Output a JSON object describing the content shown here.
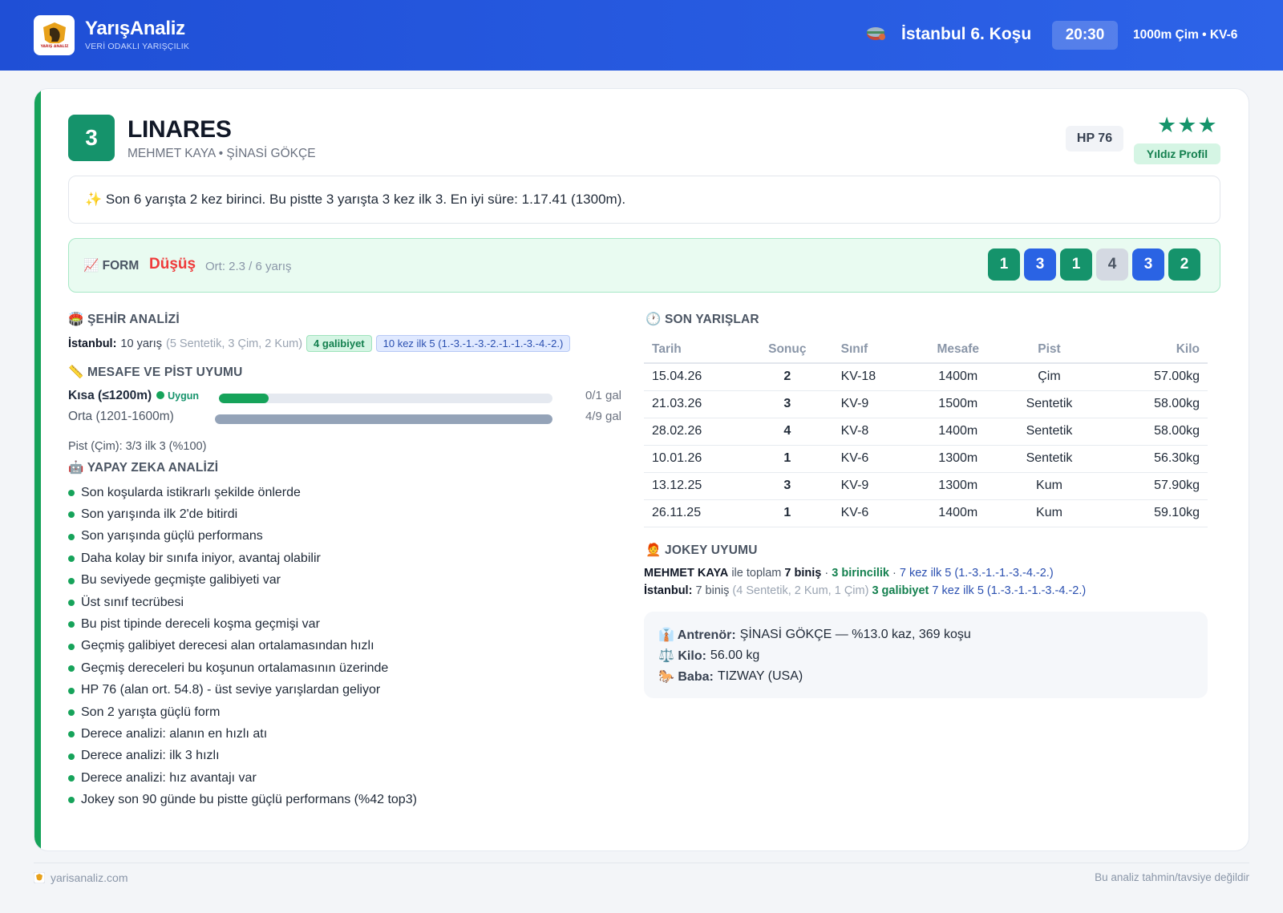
{
  "header": {
    "brand_title": "YarışAnaliz",
    "brand_subtitle": "VERİ ODAKLI YARIŞÇILIK",
    "logo_text": "YARIŞ ANALİZ",
    "race_title": "İstanbul 6. Koşu",
    "race_time": "20:30",
    "race_info": "1000m Çim • KV-6",
    "race_icon": "horseshoe-icon"
  },
  "horse": {
    "number": "3",
    "name": "LINARES",
    "people": "MEHMET KAYA • ŞİNASİ GÖKÇE",
    "hp": "HP 76",
    "stars": "★★★",
    "star_label": "Yıldız Profil"
  },
  "summary": "✨ Son 6 yarışta 2 kez birinci. Bu pistte 3 yarışta 3 kez ilk 3. En iyi süre: 1.17.41 (1300m).",
  "form": {
    "label": "📈 FORM",
    "trend": "Düşüş",
    "average": "Ort: 2.3 / 6 yarış",
    "results": [
      {
        "value": "1",
        "kind": "green"
      },
      {
        "value": "3",
        "kind": "blue"
      },
      {
        "value": "1",
        "kind": "green"
      },
      {
        "value": "4",
        "kind": "grey"
      },
      {
        "value": "3",
        "kind": "blue"
      },
      {
        "value": "2",
        "kind": "green"
      }
    ]
  },
  "city": {
    "title": "🏟️ ŞEHİR ANALİZİ",
    "city_name": "İstanbul:",
    "races": "10 yarış",
    "breakdown": "(5 Sentetik, 3 Çim, 2 Kum)",
    "wins": "4 galibiyet",
    "top5": "10 kez ilk 5 (1.-3.-1.-3.-2.-1.-1.-3.-4.-2.)"
  },
  "distance": {
    "title": "📏 MESAFE VE PİST UYUMU",
    "rows": [
      {
        "label": "Kısa (≤1200m)",
        "status": "Uygun",
        "value": "0/1 gal",
        "fill": 0.15,
        "color": "#16a35a"
      },
      {
        "label": "Orta (1201-1600m)",
        "status": "",
        "value": "4/9 gal",
        "fill": 1.0,
        "color": "#94a3b8"
      }
    ],
    "pist": "Pist (Çim): 3/3 ilk 3 (%100)"
  },
  "ai": {
    "title": "🤖 YAPAY ZEKA ANALİZİ",
    "items": [
      "Son koşularda istikrarlı şekilde önlerde",
      "Son yarışında ilk 2'de bitirdi",
      "Son yarışında güçlü performans",
      "Daha kolay bir sınıfa iniyor, avantaj olabilir",
      "Bu seviyede geçmişte galibiyeti var",
      "Üst sınıf tecrübesi",
      "Bu pist tipinde dereceli koşma geçmişi var",
      "Geçmiş galibiyet derecesi alan ortalamasından hızlı",
      "Geçmiş dereceleri bu koşunun ortalamasının üzerinde",
      "HP 76 (alan ort. 54.8) - üst seviye yarışlardan geliyor",
      "Son 2 yarışta güçlü form",
      "Derece analizi: alanın en hızlı atı",
      "Derece analizi: ilk 3 hızlı",
      "Derece analizi: hız avantajı var",
      "Jokey son 90 günde bu pistte güçlü performans (%42 top3)"
    ]
  },
  "races": {
    "title": "🕐 SON YARIŞLAR",
    "columns": [
      "Tarih",
      "Sonuç",
      "Sınıf",
      "Mesafe",
      "Pist",
      "Kilo"
    ],
    "rows": [
      [
        "15.04.26",
        "2",
        "KV-18",
        "1400m",
        "Çim",
        "57.00kg"
      ],
      [
        "21.03.26",
        "3",
        "KV-9",
        "1500m",
        "Sentetik",
        "58.00kg"
      ],
      [
        "28.02.26",
        "4",
        "KV-8",
        "1400m",
        "Sentetik",
        "58.00kg"
      ],
      [
        "10.01.26",
        "1",
        "KV-6",
        "1300m",
        "Sentetik",
        "56.30kg"
      ],
      [
        "13.12.25",
        "3",
        "KV-9",
        "1300m",
        "Kum",
        "57.90kg"
      ],
      [
        "26.11.25",
        "1",
        "KV-6",
        "1400m",
        "Kum",
        "59.10kg"
      ]
    ]
  },
  "jokey": {
    "title": "🧑‍🦰 JOKEY UYUMU",
    "line1": {
      "name": "MEHMET KAYA",
      "text1": "ile toplam",
      "rides": "7 biniş",
      "sep1": "·",
      "wins": "3 birincilik",
      "sep2": "·",
      "top5": "7 kez ilk 5 (1.-3.-1.-1.-3.-4.-2.)"
    },
    "line2": {
      "city": "İstanbul:",
      "rides": "7 biniş",
      "breakdown": "(4 Sentetik, 2 Kum, 1 Çim)",
      "wins": "3 galibiyet",
      "top5": "7 kez ilk 5 (1.-3.-1.-1.-3.-4.-2.)"
    }
  },
  "info": {
    "trainer_label": "👔 Antrenör:",
    "trainer_value": "ŞİNASİ GÖKÇE — %13.0 kaz, 369 koşu",
    "weight_label": "⚖️ Kilo:",
    "weight_value": "56.00 kg",
    "sire_label": "🐎 Baba:",
    "sire_value": "TIZWAY (USA)"
  },
  "footer": {
    "site": "yarisanaliz.com",
    "disclaimer": "Bu analiz tahmin/tavsiye değildir"
  }
}
